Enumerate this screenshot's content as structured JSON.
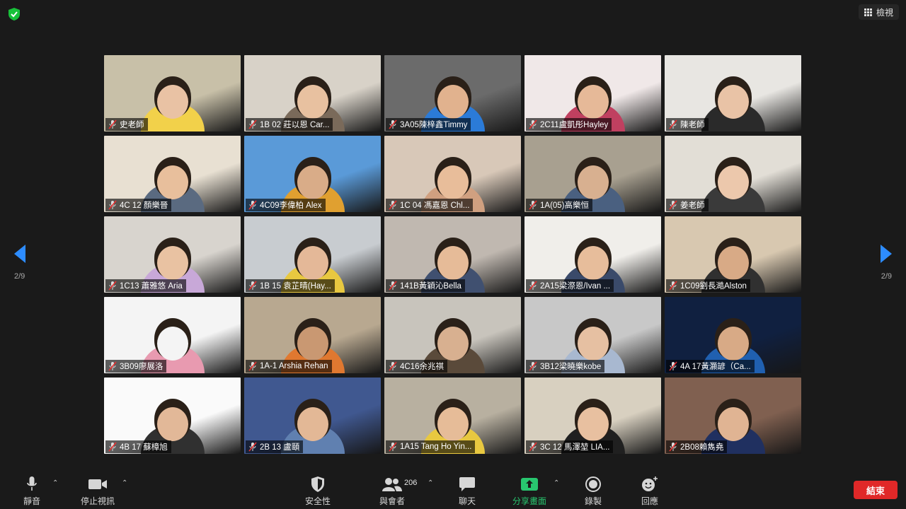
{
  "header": {
    "view_label": "檢視",
    "security_icon": "shield-check-icon"
  },
  "navigation": {
    "page_left": "2/9",
    "page_right": "2/9"
  },
  "participants": [
    {
      "name": "史老師",
      "bg": "#c8c0a8",
      "skin": "#e9c2a4",
      "shirt": "#f2d14a"
    },
    {
      "name": "1B 02 莊以恩  Car...",
      "bg": "#d8d2c8",
      "skin": "#e8c1a0",
      "shirt": "#7a6a5a"
    },
    {
      "name": "3A05陳梓鑫Timmy",
      "bg": "#6b6b6b",
      "skin": "#e1b28e",
      "shirt": "#2b7bd8"
    },
    {
      "name": "2C11盧凱彤Hayley",
      "bg": "#f0e8e8",
      "skin": "#e6b998",
      "shirt": "#c04060"
    },
    {
      "name": "陳老師",
      "bg": "#e8e6e2",
      "skin": "#e9c3a6",
      "shirt": "#2a2a2a"
    },
    {
      "name": "4C 12 顏樂晉",
      "bg": "#e8e0d2",
      "skin": "#e8bf9c",
      "shirt": "#5a6a80"
    },
    {
      "name": "4C09李偉柏 Alex",
      "bg": "#5a9ad8",
      "skin": "#d9ac88",
      "shirt": "#e0a030"
    },
    {
      "name": "1C 04  馮嘉恩 Chl...",
      "bg": "#d8c8b8",
      "skin": "#e8bd9a",
      "shirt": "#d0a080"
    },
    {
      "name": "1A(05)高樂恒",
      "bg": "#a8a090",
      "skin": "#d8b090",
      "shirt": "#4a6080"
    },
    {
      "name": "姜老師",
      "bg": "#e2ded6",
      "skin": "#ecc8ac",
      "shirt": "#3a3a3a"
    },
    {
      "name": "1C13 蕭雅悠 Aria",
      "bg": "#d8d4ce",
      "skin": "#e9c2a2",
      "shirt": "#c8a8d8"
    },
    {
      "name": "1B 15 袁芷晴(Hay...",
      "bg": "#c8ccd0",
      "skin": "#e4b898",
      "shirt": "#e8c840"
    },
    {
      "name": "141B黃穎沁Bella",
      "bg": "#c0b8b0",
      "skin": "#e6bb98",
      "shirt": "#405070"
    },
    {
      "name": "2A15梁漈恩/Ivan ...",
      "bg": "#f0eeea",
      "skin": "#e7bd9b",
      "shirt": "#3a4a6a"
    },
    {
      "name": "1C09劉長澔Alston",
      "bg": "#d8c8b0",
      "skin": "#d8aa86",
      "shirt": "#303030"
    },
    {
      "name": "3B09廖展洛",
      "bg": "#f4f4f4",
      "skin": "#f4f4f4",
      "shirt": "#e89ab0"
    },
    {
      "name": "1A-1 Arshia Rehan",
      "bg": "#b8a890",
      "skin": "#c99872",
      "shirt": "#e07830"
    },
    {
      "name": "4C16余兆祺",
      "bg": "#c8c4bc",
      "skin": "#d8b090",
      "shirt": "#5a4a3a"
    },
    {
      "name": "3B12梁曉樂kobe",
      "bg": "#c8c8c8",
      "skin": "#e6c0a2",
      "shirt": "#a8b8d0"
    },
    {
      "name": "4A 17黃灝諺（Ca...",
      "bg": "#102040",
      "skin": "#d8aa86",
      "shirt": "#2060b0"
    },
    {
      "name": "4B 17 蘇樟旭",
      "bg": "#fafafa",
      "skin": "#e2b898",
      "shirt": "#303030"
    },
    {
      "name": "2B 13 盧頤",
      "bg": "#405890",
      "skin": "#e3b896",
      "shirt": "#6080b0"
    },
    {
      "name": "1A15 Tang Ho Yin...",
      "bg": "#b8b0a0",
      "skin": "#e6bc98",
      "shirt": "#e8c840"
    },
    {
      "name": "3C 12  馬澤堃 LIA...",
      "bg": "#d8d0c0",
      "skin": "#e8c0a0",
      "shirt": "#202020"
    },
    {
      "name": "2B08賴雋堯",
      "bg": "#806050",
      "skin": "#e0b493",
      "shirt": "#203060"
    }
  ],
  "toolbar": {
    "mute_label": "靜音",
    "stop_video_label": "停止視訊",
    "security_label": "安全性",
    "participants_label": "與會者",
    "participants_count": "206",
    "chat_label": "聊天",
    "share_label": "分享畫面",
    "record_label": "錄製",
    "reactions_label": "回應",
    "end_label": "結束"
  }
}
